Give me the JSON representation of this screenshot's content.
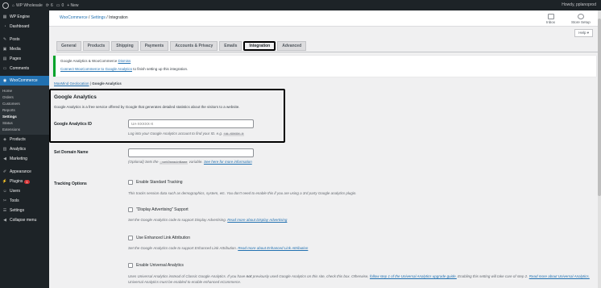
{
  "adminbar": {
    "site_name": "WP Wholesale",
    "updates": "6",
    "comments": "0",
    "new_label": "+ New",
    "howdy": "Howdy, pplanoprod"
  },
  "sidebar": {
    "items": [
      {
        "label": "WP Engine",
        "icon": "wpengine-icon"
      },
      {
        "label": "Dashboard",
        "icon": "dashboard-icon"
      },
      {
        "label": "Posts",
        "icon": "pin-icon"
      },
      {
        "label": "Media",
        "icon": "media-icon"
      },
      {
        "label": "Pages",
        "icon": "pages-icon"
      },
      {
        "label": "Comments",
        "icon": "comment-icon"
      },
      {
        "label": "WooCommerce",
        "icon": "woo-icon"
      }
    ],
    "submenu": [
      "Home",
      "Orders",
      "Customers",
      "Reports",
      "Settings",
      "Status",
      "Extensions"
    ],
    "items_after": [
      {
        "label": "Products",
        "icon": "products-icon"
      },
      {
        "label": "Analytics",
        "icon": "analytics-icon"
      },
      {
        "label": "Marketing",
        "icon": "megaphone-icon"
      },
      {
        "label": "Appearance",
        "icon": "brush-icon"
      },
      {
        "label": "Plugins",
        "icon": "plugin-icon",
        "badge": "1"
      },
      {
        "label": "Users",
        "icon": "users-icon"
      },
      {
        "label": "Tools",
        "icon": "wrench-icon"
      },
      {
        "label": "Settings",
        "icon": "settings-icon"
      },
      {
        "label": "Collapse menu",
        "icon": "collapse-icon"
      }
    ]
  },
  "header": {
    "breadcrumb_root": "WooCommerce",
    "breadcrumb_mid": "Settings",
    "breadcrumb_current": "Integration",
    "inbox": "Inbox",
    "store_setup": "Store Setup",
    "help": "Help ▾"
  },
  "tabs": [
    "General",
    "Products",
    "Shipping",
    "Payments",
    "Accounts & Privacy",
    "Emails",
    "Integration",
    "Advanced"
  ],
  "notice": {
    "line1": "Google Analytics & WooCommerce",
    "dismiss": "Dismiss",
    "link": "Connect WooCommerce to Google Analytics",
    "line2_rest": " to finish setting up this integration."
  },
  "subsub": {
    "link": "MaxMind Geolocation",
    "sep": " | ",
    "current": "Google Analytics"
  },
  "ga": {
    "title": "Google Analytics",
    "description": "Google Analytics is a free service offered by Google that generates detailed statistics about the visitors to a website."
  },
  "fields": {
    "id_label": "Google Analytics ID",
    "id_placeholder": "UA-XXXXX-X",
    "id_desc": "Log into your Google Analytics account to find your ID. e.g.",
    "id_example": "UA-XXXXX-X",
    "domain_label": "Set Domain Name",
    "domain_desc_a": "(Optional) Sets the",
    "domain_code": "_setDomainName",
    "domain_desc_b": "variable.",
    "domain_link": "See here for more information",
    "tracking_label": "Tracking Options"
  },
  "tracking": {
    "standard": "Enable Standard Tracking",
    "standard_desc": "This tracks session data such as demographics, system, etc. You don't need to enable this if you are using a 3rd party Google analytics plugin.",
    "display": "\"Display Advertising\" Support",
    "display_desc": "Set the Google Analytics code to support Display Advertising.",
    "display_link": "Read more about Display Advertising",
    "enhanced": "Use Enhanced Link Attribution",
    "enhanced_desc": "Set the Google Analytics code to support Enhanced Link Attribution.",
    "enhanced_link": "Read more about Enhanced Link Attribution",
    "universal": "Enable Universal Analytics",
    "universal_desc_a": "Uses Universal Analytics instead of Classic Google Analytics. If you have",
    "universal_not": "not",
    "universal_desc_b": "previously used Google Analytics on this site, check this box. Otherwise,",
    "universal_link1": "follow step 1 of the Universal Analytics upgrade guide.",
    "universal_desc_c": "Enabling this setting",
    "universal_desc_d": "will take care of step 2.",
    "universal_link2": "Read more about Universal Analytics.",
    "universal_desc_e": "Universal Analytics must be enabled to enable enhanced eCommerce."
  },
  "colors": {
    "admin_dark": "#1d2327",
    "accent": "#2271b1",
    "notice_green": "#00a32a"
  }
}
